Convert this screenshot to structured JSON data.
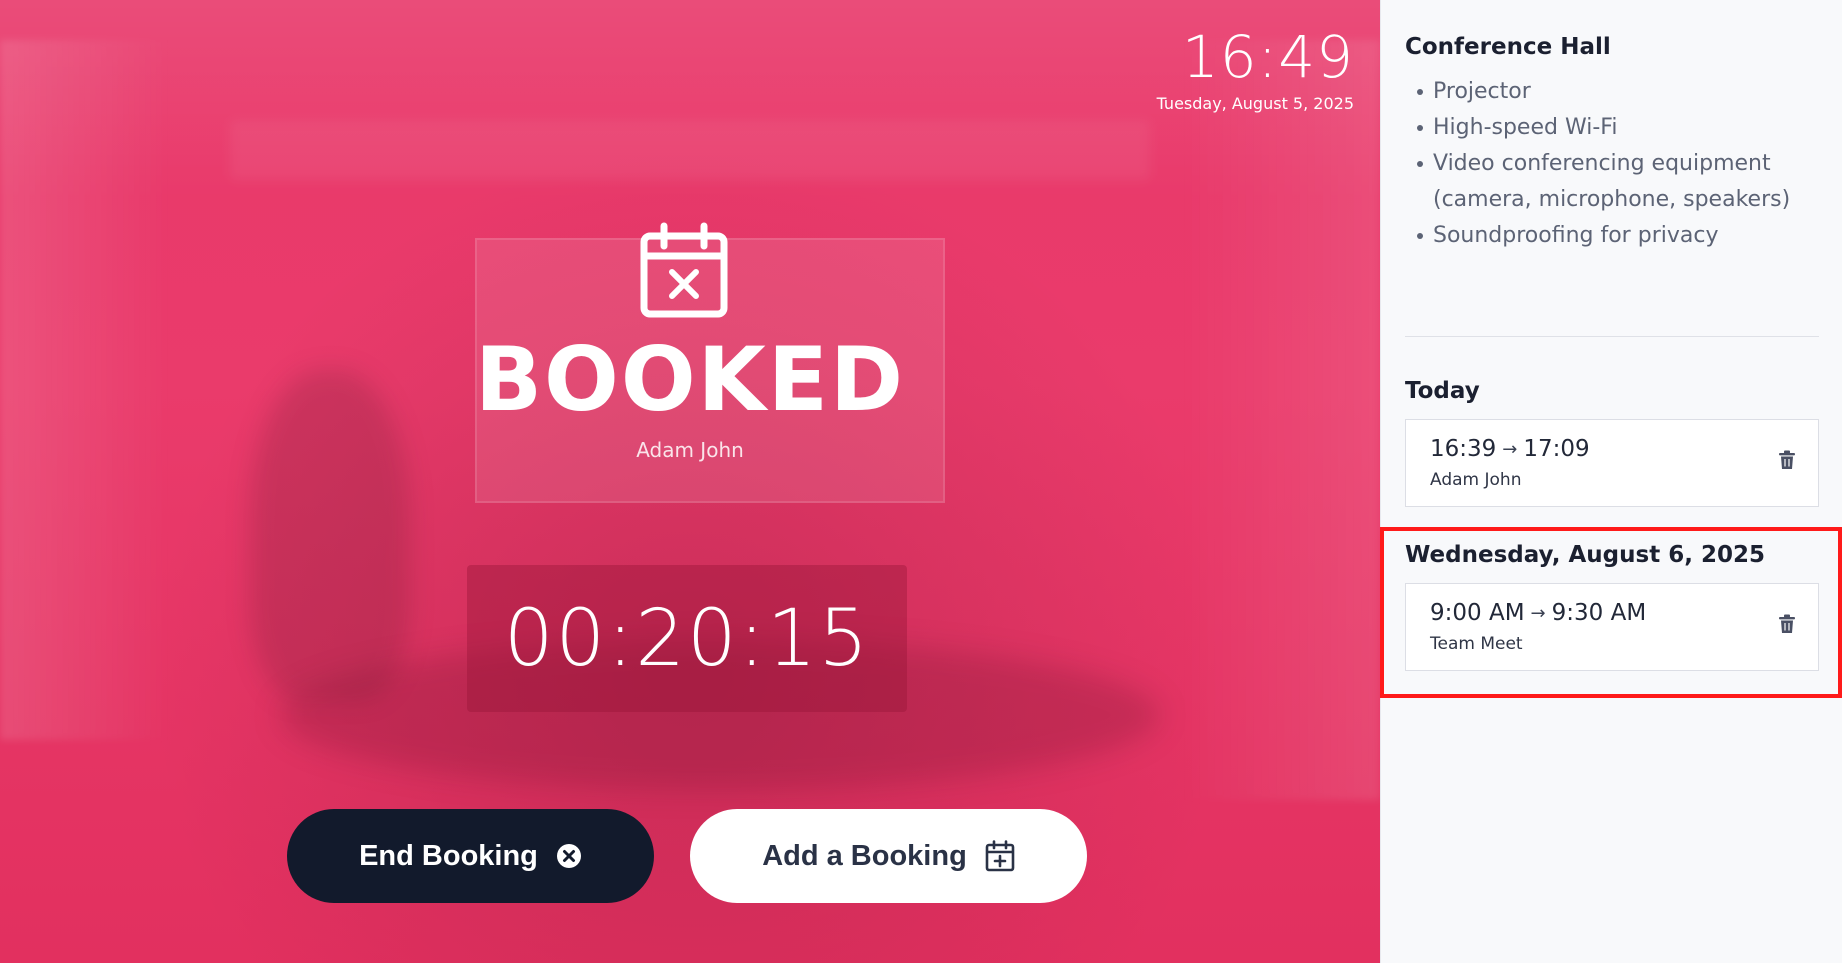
{
  "clock": {
    "time": "16:49",
    "date": "Tuesday, August 5, 2025"
  },
  "status": {
    "label": "BOOKED",
    "booked_by": "Adam John",
    "countdown": "00:20:15",
    "icon": "calendar-x-icon",
    "background_color": "#e8386a"
  },
  "actions": {
    "end_booking_label": "End Booking",
    "end_booking_icon": "circle-x-icon",
    "add_booking_label": "Add a Booking",
    "add_booking_icon": "calendar-plus-icon"
  },
  "sidebar": {
    "room_name": "Conference Hall",
    "amenities": [
      "Projector",
      "High-speed Wi-Fi",
      "Video conferencing equipment (camera, microphone, speakers)",
      "Soundproofing for privacy"
    ],
    "days": [
      {
        "title": "Today",
        "bookings": [
          {
            "start": "16:39",
            "end": "17:09",
            "name": "Adam John"
          }
        ]
      },
      {
        "title": "Wednesday, August 6, 2025",
        "bookings": [
          {
            "start": "9:00 AM",
            "end": "9:30 AM",
            "name": "Team Meet"
          }
        ]
      }
    ]
  },
  "colors": {
    "accent": "#e8386a",
    "dark_button": "#121a2c",
    "highlight": "#ff1a1a"
  }
}
